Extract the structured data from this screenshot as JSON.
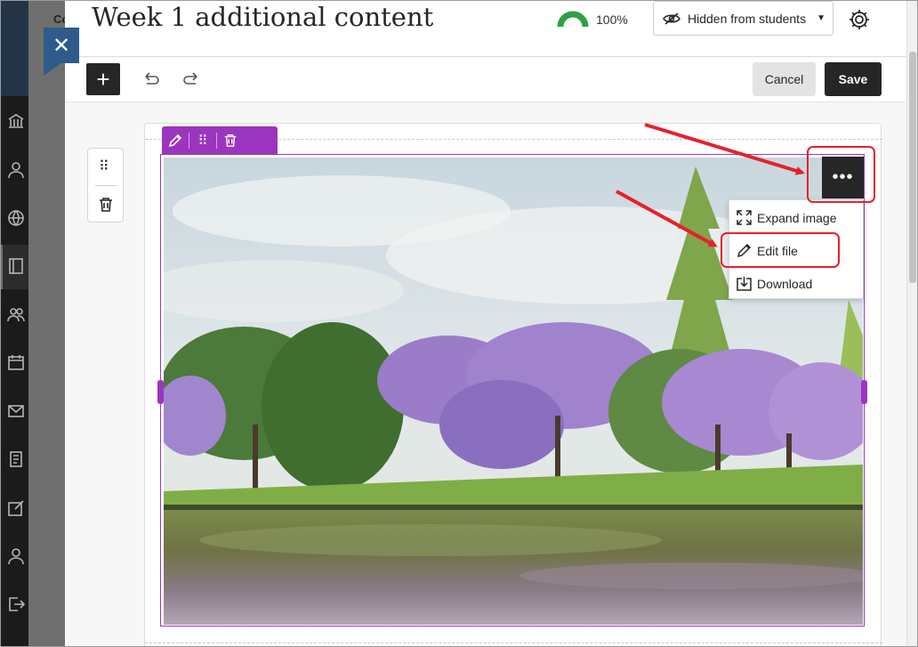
{
  "page": {
    "title": "Week 1 additional content"
  },
  "background_app": {
    "course_label_fragment": "Co"
  },
  "header": {
    "progress_value": "100%",
    "progress_fraction": 1.0,
    "visibility_label": "Hidden from students"
  },
  "toolbar": {
    "cancel_label": "Cancel",
    "save_label": "Save"
  },
  "image_menu": {
    "items": [
      {
        "label": "Expand image",
        "icon": "expand-icon"
      },
      {
        "label": "Edit file",
        "icon": "pencil-icon"
      },
      {
        "label": "Download",
        "icon": "download-icon"
      }
    ]
  },
  "colors": {
    "accent_purple": "#9b35bf",
    "progress_green": "#2ea043",
    "annotation_red": "#e8202a",
    "close_tab_blue": "#2e5b8c"
  },
  "icons": {
    "sidebar": [
      "institution-icon",
      "user-icon",
      "globe-icon",
      "book-icon",
      "people-icon",
      "calendar-icon",
      "mail-icon",
      "document-icon",
      "edit-icon",
      "user-icon",
      "logout-icon"
    ],
    "block_tools": [
      "drag-handle-icon",
      "trash-icon"
    ],
    "purple_toolbar": [
      "pencil-icon",
      "drag-handle-icon",
      "trash-icon"
    ]
  }
}
